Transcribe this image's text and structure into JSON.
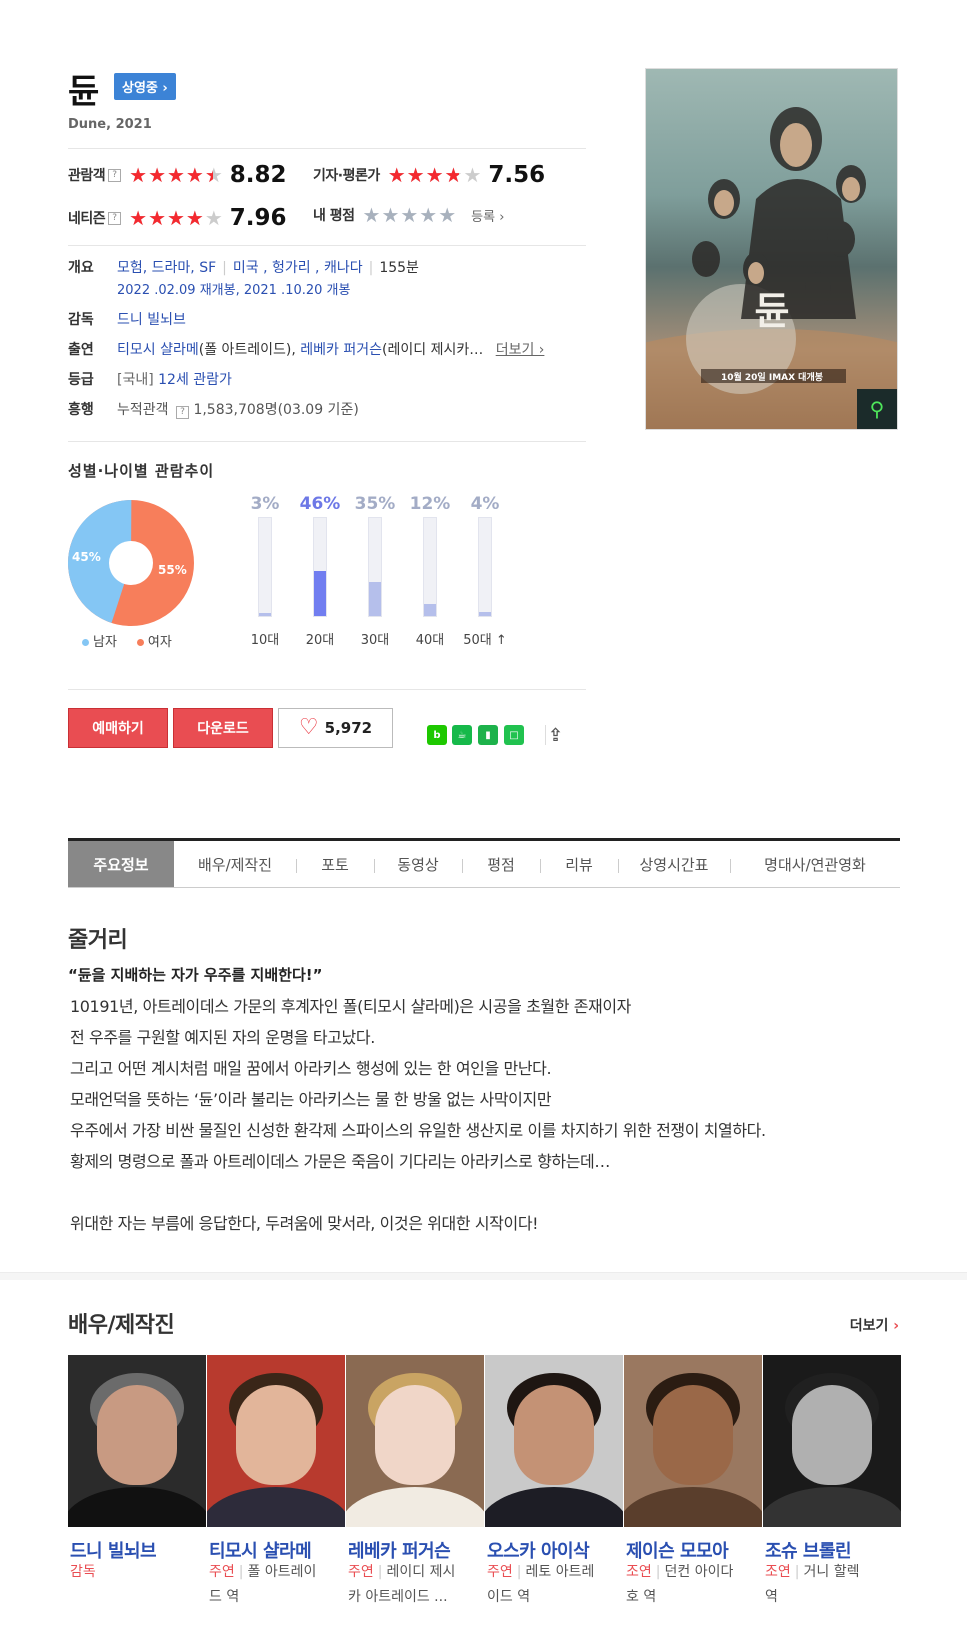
{
  "movie": {
    "title": "듄",
    "status_badge": "상영중 ›",
    "subtitle": "Dune, 2021"
  },
  "ratings": {
    "audience": {
      "label": "관람객",
      "score": "8.82",
      "stars_fraction": 0.882
    },
    "critic": {
      "label": "기자·평론가",
      "score": "7.56",
      "stars_fraction": 0.756
    },
    "netizen": {
      "label": "네티즌",
      "score": "7.96",
      "stars_fraction": 0.796
    },
    "mine": {
      "label": "내 평점",
      "register": "등록 ›"
    },
    "help_glyph": "?"
  },
  "info": {
    "overview_label": "개요",
    "genres": "모험, 드라마, SF",
    "countries": "미국 , 헝가리 , 캐나다",
    "runtime": "155분",
    "release": "2022 .02.09 재개봉, 2021 .10.20 개봉",
    "director_label": "감독",
    "director": "드니 빌뇌브",
    "cast_label": "출연",
    "cast_1": "티모시 샬라메",
    "cast_1_role": "(폴 아트레이드),",
    "cast_2": "레베카 퍼거슨",
    "cast_2_role": "(레이디 제시카…",
    "cast_more": "더보기 ›",
    "grade_label": "등급",
    "grade_prefix": "[국내]",
    "grade": "12세 관람가",
    "boxoffice_label": "흥행",
    "boxoffice_text": "누적관객",
    "boxoffice_value": "1,583,708명(03.09 기준)"
  },
  "demographics": {
    "heading": "성별·나이별 관람추이",
    "gender": {
      "male_pct": 45,
      "female_pct": 55,
      "male_label": "45%",
      "female_label": "55%",
      "legend_male": "남자",
      "legend_female": "여자",
      "male_color": "#84c6f4",
      "female_color": "#f77e5b"
    },
    "ages": [
      {
        "label": "10대",
        "pct": 3,
        "pct_label": "3%",
        "highlight": false
      },
      {
        "label": "20대",
        "pct": 46,
        "pct_label": "46%",
        "highlight": true
      },
      {
        "label": "30대",
        "pct": 35,
        "pct_label": "35%",
        "highlight": false
      },
      {
        "label": "40대",
        "pct": 12,
        "pct_label": "12%",
        "highlight": false
      },
      {
        "label": "50대 ↑",
        "pct": 4,
        "pct_label": "4%",
        "highlight": false
      }
    ]
  },
  "actions": {
    "reserve": "예매하기",
    "download": "다운로드",
    "likes": "5,972",
    "share_icons": [
      "blog-share-icon",
      "cafe-share-icon",
      "bookmark-share-icon",
      "memo-share-icon",
      "share-icon"
    ]
  },
  "tabs": [
    "주요정보",
    "배우/제작진",
    "포토",
    "동영상",
    "평점",
    "리뷰",
    "상영시간표",
    "명대사/연관영화"
  ],
  "synopsis": {
    "heading": "줄거리",
    "tagline": "“듄을 지배하는 자가 우주를 지배한다!”",
    "lines": [
      "10191년, 아트레이데스 가문의 후계자인 폴(티모시 샬라메)은 시공을 초월한 존재이자",
      " 전 우주를 구원할 예지된 자의 운명을 타고났다.",
      " 그리고 어떤 계시처럼 매일 꿈에서 아라키스 행성에 있는 한 여인을 만난다.",
      " 모래언덕을 뜻하는 ‘듄’이라 불리는 아라키스는 물 한 방울 없는 사막이지만",
      " 우주에서 가장 비싼 물질인 신성한 환각제 스파이스의 유일한 생산지로 이를 차지하기 위한 전쟁이 치열하다.",
      " 황제의 명령으로 폴과 아트레이데스 가문은 죽음이 기다리는 아라키스로 향하는데…",
      "",
      " 위대한 자는 부름에 응답한다, 두려움에 맞서라, 이것은 위대한 시작이다!"
    ]
  },
  "cast_section": {
    "heading": "배우/제작진",
    "more": "더보기",
    "more_chevron": "›",
    "members": [
      {
        "name": "드니 빌뇌브",
        "kind": "감독",
        "role_1": "",
        "role_2": ""
      },
      {
        "name": "티모시 샬라메",
        "kind": "주연",
        "role_1": "폴 아트레이",
        "role_2": "드 역"
      },
      {
        "name": "레베카 퍼거슨",
        "kind": "주연",
        "role_1": "레이디 제시",
        "role_2": "카 아트레이드 ..."
      },
      {
        "name": "오스카 아이삭",
        "kind": "주연",
        "role_1": "레토 아트레",
        "role_2": "이드 역"
      },
      {
        "name": "제이슨 모모아",
        "kind": "조연",
        "role_1": "던컨 아이다",
        "role_2": "호 역"
      },
      {
        "name": "조슈 브롤린",
        "kind": "조연",
        "role_1": "거니 할렉",
        "role_2": "역"
      }
    ]
  },
  "colors": {
    "accent_red": "#e94d52",
    "link_blue": "#2a4fb1",
    "star_red": "#f4292f"
  }
}
